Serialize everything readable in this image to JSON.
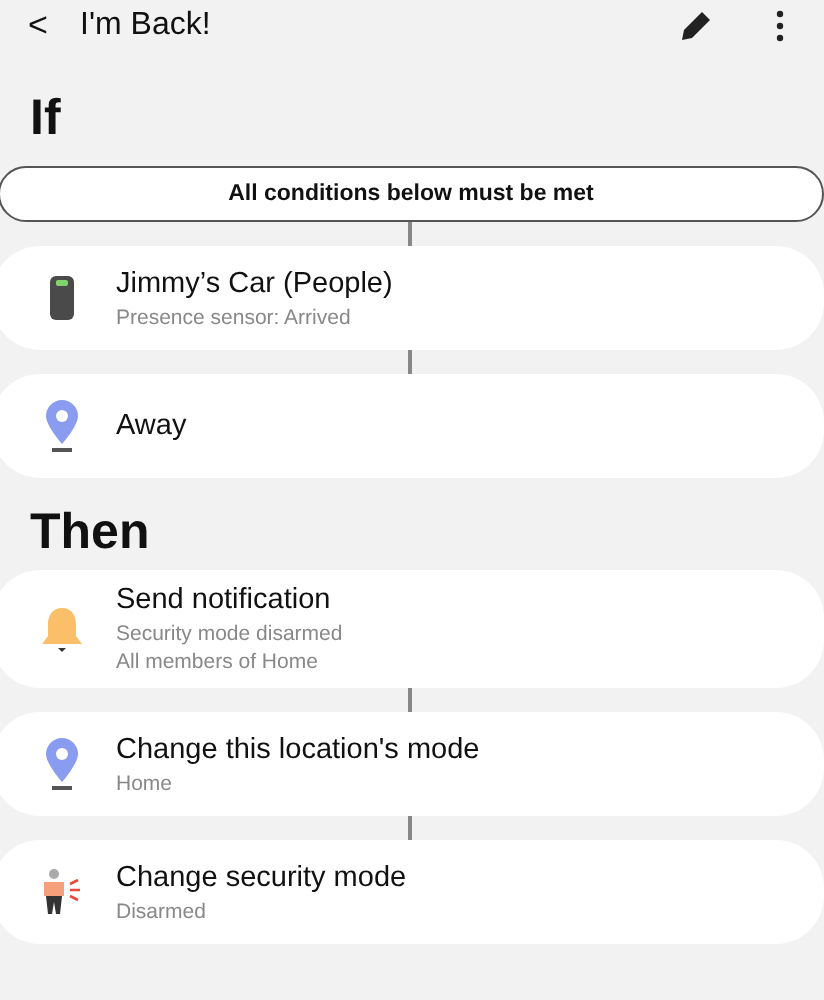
{
  "header": {
    "back": "<",
    "title": "I'm Back!"
  },
  "if_section": {
    "heading": "If",
    "condition_mode": "All conditions below must be met",
    "items": [
      {
        "kind": "sensor",
        "title": "Jimmy’s Car (People)",
        "details": [
          "Presence sensor: Arrived"
        ]
      },
      {
        "kind": "location",
        "title": "Away"
      }
    ]
  },
  "then_section": {
    "heading": "Then",
    "items": [
      {
        "kind": "notification",
        "title": "Send notification",
        "details": [
          "Security mode disarmed",
          "All members of Home"
        ]
      },
      {
        "kind": "location",
        "title": "Change this location's mode",
        "details": [
          "Home"
        ]
      },
      {
        "kind": "security",
        "title": "Change security mode",
        "details": [
          "Disarmed"
        ]
      }
    ]
  }
}
